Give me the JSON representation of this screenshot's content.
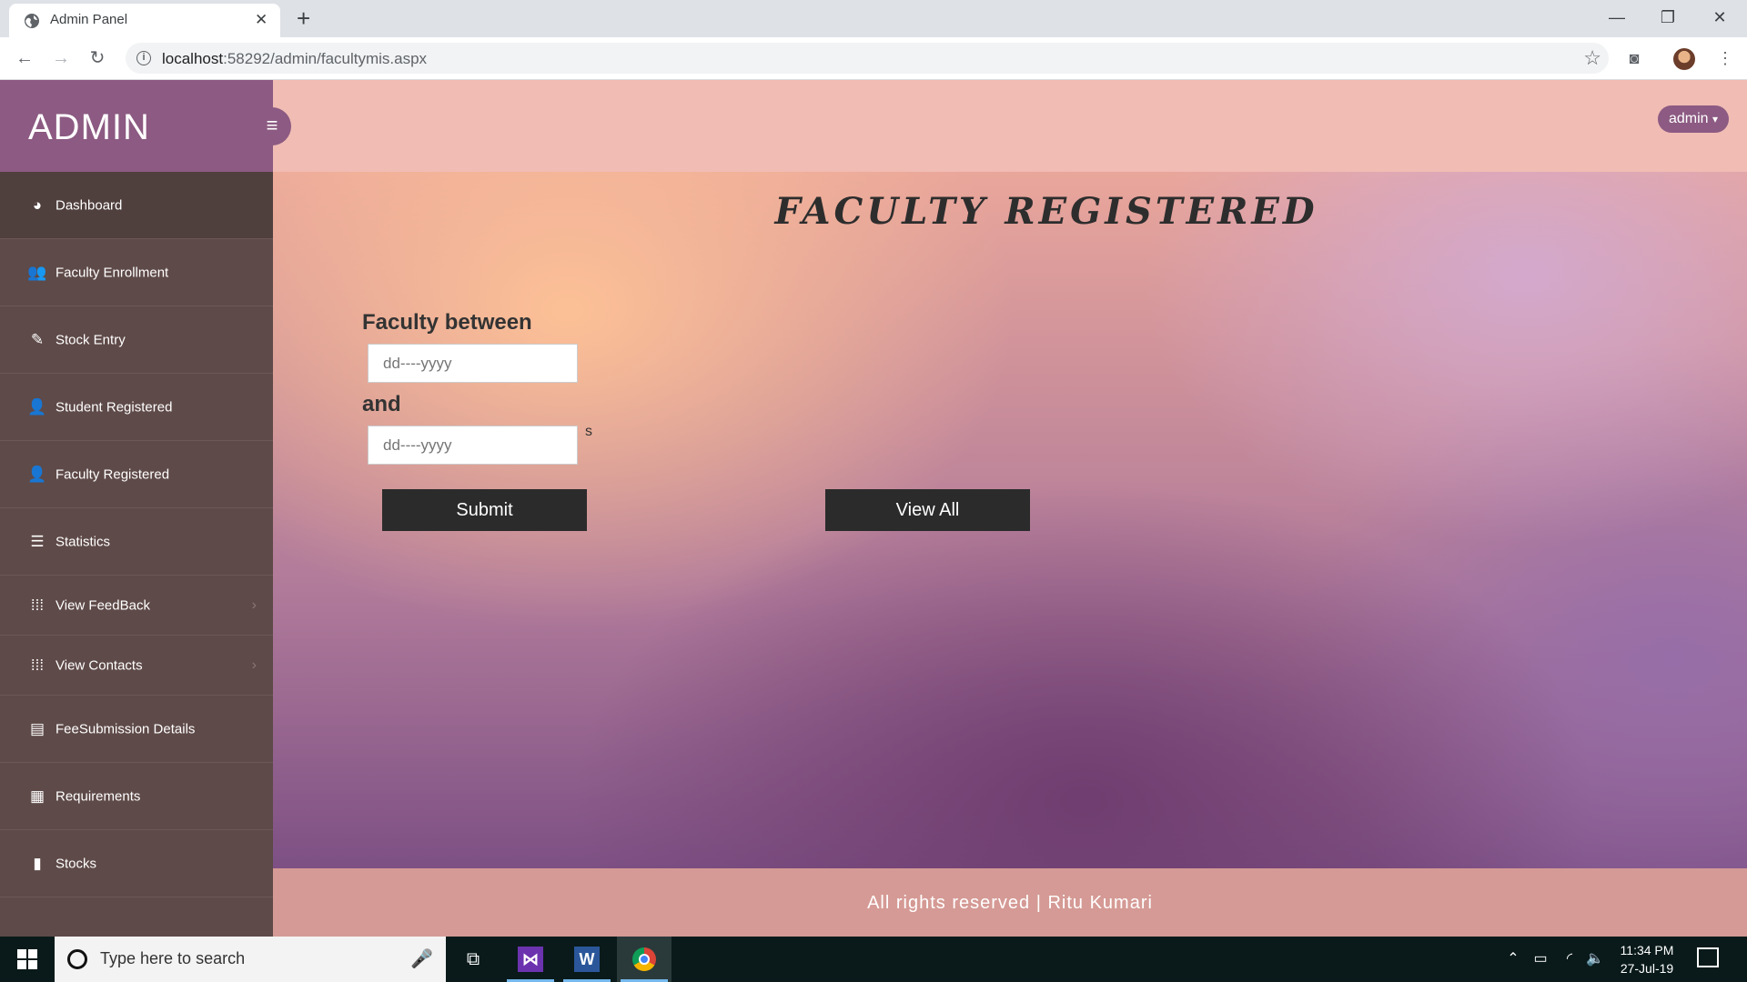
{
  "browser": {
    "tab_title": "Admin Panel",
    "tab_close": "✕",
    "new_tab": "+",
    "url_host": "localhost",
    "url_rest": ":58292/admin/facultymis.aspx",
    "window_controls": {
      "minimize": "—",
      "restore": "❐",
      "close": "✕"
    },
    "nav": {
      "back": "←",
      "forward": "→",
      "reload": "↻"
    }
  },
  "sidebar": {
    "brand": "ADMIN",
    "toggle_icon": "≡",
    "items": [
      {
        "label": "Dashboard",
        "icon": "dashboard-icon",
        "glyph": "◕",
        "active": true
      },
      {
        "label": "Faculty Enrollment",
        "icon": "users-icon",
        "glyph": "👥"
      },
      {
        "label": "Stock Entry",
        "icon": "edit-icon",
        "glyph": "✎"
      },
      {
        "label": "Student Registered",
        "icon": "user-icon",
        "glyph": "👤"
      },
      {
        "label": "Faculty Registered",
        "icon": "user-plus-icon",
        "glyph": "👤"
      },
      {
        "label": "Statistics",
        "icon": "list-icon",
        "glyph": "☰"
      },
      {
        "label": "View FeedBack",
        "icon": "grid-icon",
        "glyph": "⁞⁞⁞",
        "chevron": "›"
      },
      {
        "label": "View Contacts",
        "icon": "grid-icon",
        "glyph": "⁞⁞⁞",
        "chevron": "›"
      },
      {
        "label": "FeeSubmission Details",
        "icon": "book-icon",
        "glyph": "▤"
      },
      {
        "label": "Requirements",
        "icon": "tasks-icon",
        "glyph": "▦"
      },
      {
        "label": "Stocks",
        "icon": "briefcase-icon",
        "glyph": "▮"
      }
    ]
  },
  "header": {
    "user_label": "admin",
    "user_caret": "▾"
  },
  "main": {
    "title": "FACULTY REGISTERED",
    "label_between": "Faculty between",
    "label_and": "and",
    "date_from_placeholder": "dd----yyyy",
    "date_to_placeholder": "dd----yyyy",
    "stray_text": "s",
    "submit_label": "Submit",
    "view_all_label": "View All"
  },
  "footer": {
    "text": "All rights reserved | Ritu Kumari"
  },
  "taskbar": {
    "search_placeholder": "Type here to search",
    "time": "11:34 PM",
    "date": "27-Jul-19"
  }
}
